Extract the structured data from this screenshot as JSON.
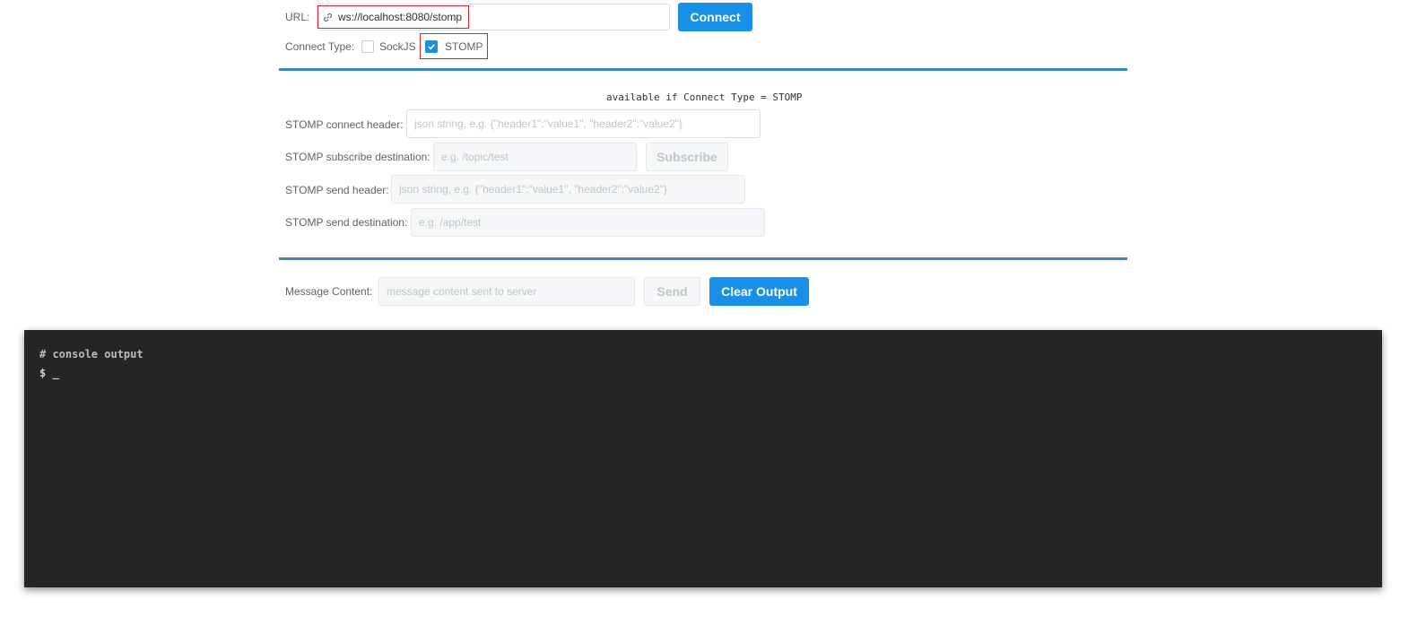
{
  "connection": {
    "url_label": "URL:",
    "url_value": "ws://localhost:8080/stomp",
    "connect_button": "Connect",
    "type_label": "Connect Type:",
    "options": [
      {
        "label": "SockJS",
        "checked": false
      },
      {
        "label": "STOMP",
        "checked": true
      }
    ]
  },
  "stomp": {
    "note": "available if Connect Type = STOMP",
    "connect_header_label": "STOMP connect header:",
    "connect_header_placeholder": "json string, e.g. {\"header1\":\"value1\", \"header2\":\"value2\"}",
    "subscribe_dest_label": "STOMP subscribe destination:",
    "subscribe_dest_placeholder": "e.g. /topic/test",
    "subscribe_button": "Subscribe",
    "send_header_label": "STOMP send header:",
    "send_header_placeholder": "json string, e.g. {\"header1\":\"value1\", \"header2\":\"value2\"}",
    "send_dest_label": "STOMP send destination:",
    "send_dest_placeholder": "e.g. /app/test"
  },
  "message": {
    "label": "Message Content:",
    "placeholder": "message content sent to server",
    "send_button": "Send",
    "clear_button": "Clear Output"
  },
  "console": {
    "lines": [
      "# console output",
      "$ _"
    ]
  },
  "colors": {
    "primary": "#1890e8",
    "divider": "#3a87c3",
    "highlight": "#e0232a",
    "console_bg": "#252525"
  },
  "icons": {
    "url_prefix": "link-icon",
    "checkbox_checked": "check-icon"
  }
}
